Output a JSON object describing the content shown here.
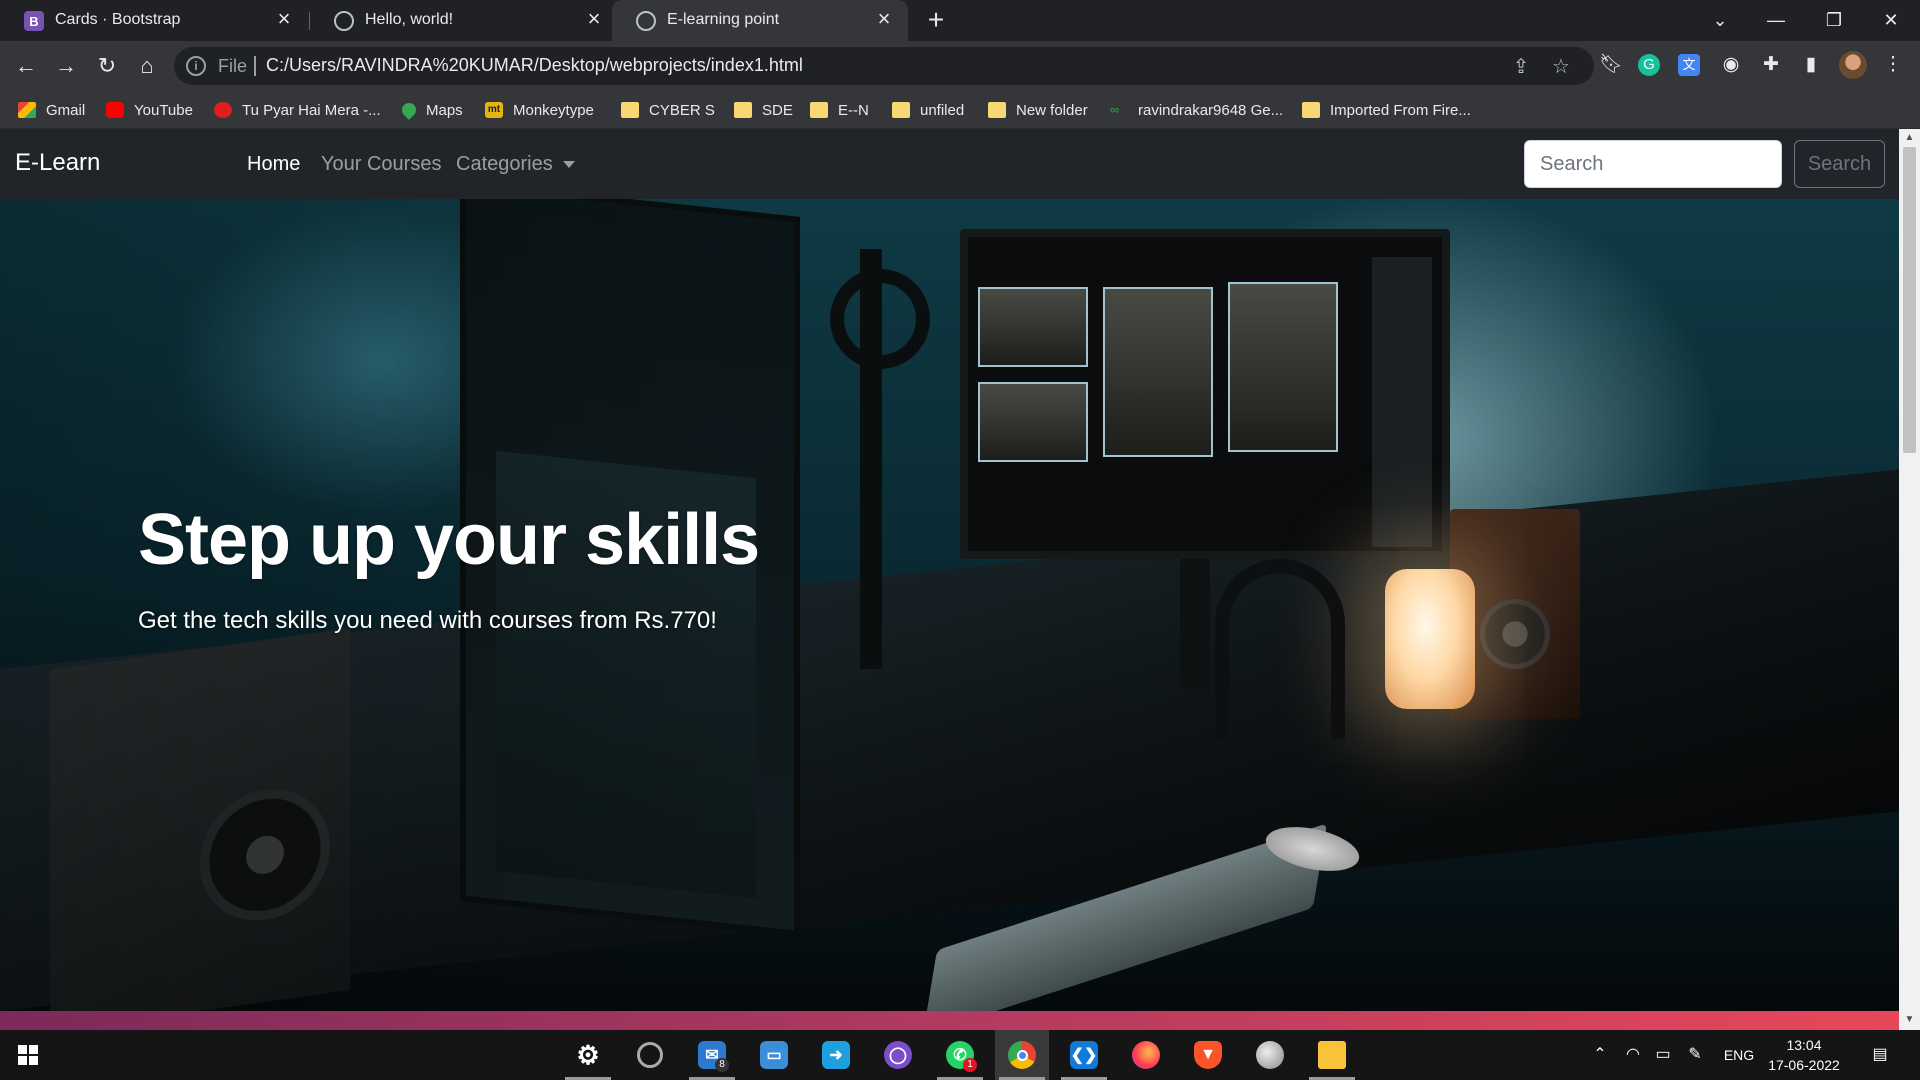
{
  "browser": {
    "tabs": [
      {
        "label": "Cards · Bootstrap",
        "favicon": "bootstrap-icon",
        "active": false
      },
      {
        "label": "Hello, world!",
        "favicon": "globe-icon",
        "active": false
      },
      {
        "label": "E-learning point",
        "favicon": "globe-icon",
        "active": true
      }
    ],
    "address": {
      "scheme_label": "File",
      "url": "C:/Users/RAVINDRA%20KUMAR/Desktop/webprojects/index1.html"
    },
    "bookmarks": [
      {
        "label": "Gmail",
        "icon": "gmail-icon"
      },
      {
        "label": "YouTube",
        "icon": "youtube-icon"
      },
      {
        "label": "Tu Pyar Hai Mera -...",
        "icon": "music-icon"
      },
      {
        "label": "Maps",
        "icon": "maps-icon"
      },
      {
        "label": "Monkeytype",
        "icon": "monkeytype-icon"
      },
      {
        "label": "CYBER S",
        "icon": "folder-icon"
      },
      {
        "label": "SDE",
        "icon": "folder-icon"
      },
      {
        "label": "E--N",
        "icon": "folder-icon"
      },
      {
        "label": "unfiled",
        "icon": "folder-icon"
      },
      {
        "label": "New folder",
        "icon": "folder-icon"
      },
      {
        "label": "ravindrakar9648 Ge...",
        "icon": "geeksforgeeks-icon"
      },
      {
        "label": "Imported From Fire...",
        "icon": "folder-icon"
      }
    ]
  },
  "site": {
    "brand": "E-Learn",
    "nav": {
      "home": "Home",
      "courses": "Your Courses",
      "categories": "Categories"
    },
    "search": {
      "placeholder": "Search",
      "button_label": "Search"
    },
    "hero": {
      "title": "Step up your skills",
      "subtitle": "Get the tech skills you need with courses from Rs.770!"
    },
    "colors": {
      "navbar_bg": "#212529",
      "accent_start": "#7b2a5a",
      "accent_end": "#e8475a"
    }
  },
  "taskbar": {
    "apps": [
      {
        "name": "settings-icon"
      },
      {
        "name": "media-icon"
      },
      {
        "name": "mail-icon",
        "badge": "8"
      },
      {
        "name": "computer-icon"
      },
      {
        "name": "remote-icon"
      },
      {
        "name": "github-icon"
      },
      {
        "name": "whatsapp-icon",
        "badge": "1"
      },
      {
        "name": "chrome-icon"
      },
      {
        "name": "vscode-icon"
      },
      {
        "name": "firefox-icon"
      },
      {
        "name": "brave-icon"
      },
      {
        "name": "paint-icon"
      },
      {
        "name": "file-explorer-icon"
      }
    ],
    "tray": {
      "language": "ENG",
      "time": "13:04",
      "date": "17-06-2022"
    }
  }
}
